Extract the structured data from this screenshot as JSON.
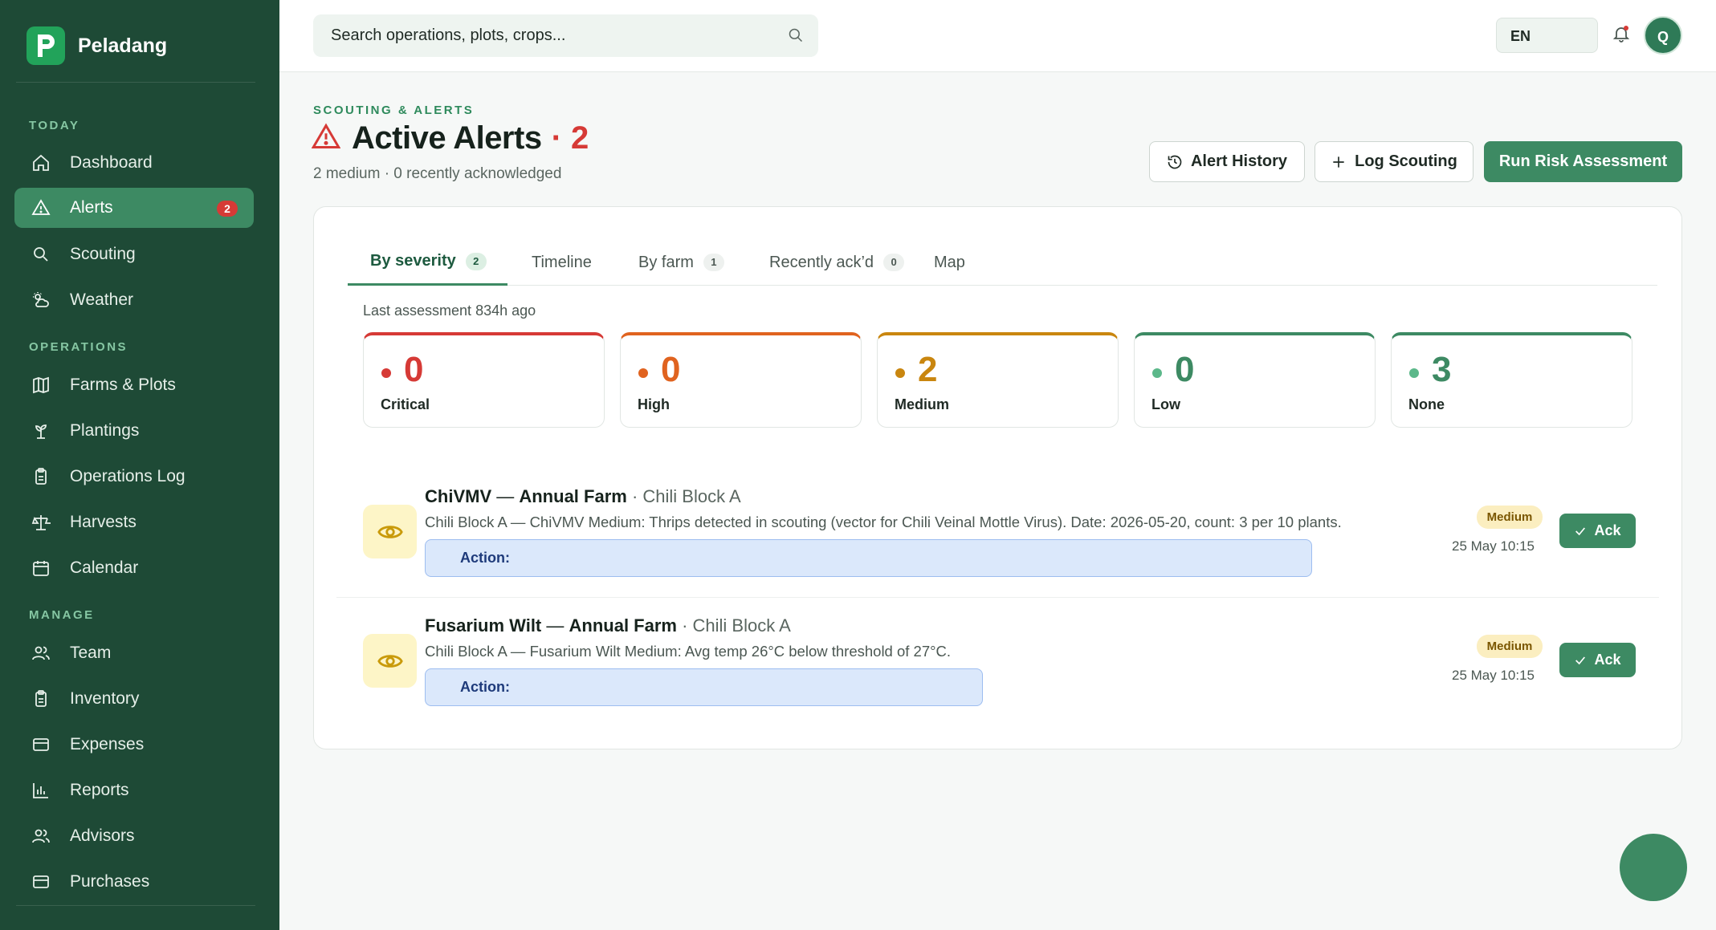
{
  "brand": {
    "name": "Peladang",
    "logo_letter": "P"
  },
  "sidebar": {
    "sections": [
      {
        "label": "TODAY"
      },
      {
        "label": "OPERATIONS"
      },
      {
        "label": "MANAGE"
      }
    ],
    "items": [
      {
        "label": "Dashboard",
        "icon": "home-icon"
      },
      {
        "label": "Alerts",
        "icon": "warning-icon",
        "badge": "2",
        "active": true
      },
      {
        "label": "Scouting",
        "icon": "search-icon"
      },
      {
        "label": "Weather",
        "icon": "weather-icon"
      },
      {
        "label": "Farms & Plots",
        "icon": "map-icon"
      },
      {
        "label": "Plantings",
        "icon": "sprout-icon"
      },
      {
        "label": "Operations Log",
        "icon": "clipboard-icon"
      },
      {
        "label": "Harvests",
        "icon": "scale-icon"
      },
      {
        "label": "Calendar",
        "icon": "calendar-icon"
      },
      {
        "label": "Team",
        "icon": "users-icon"
      },
      {
        "label": "Inventory",
        "icon": "clipboard-icon"
      },
      {
        "label": "Expenses",
        "icon": "card-icon"
      },
      {
        "label": "Reports",
        "icon": "bar-chart-icon"
      },
      {
        "label": "Advisors",
        "icon": "users-icon"
      },
      {
        "label": "Purchases",
        "icon": "card-icon"
      }
    ]
  },
  "topbar": {
    "search_placeholder": "Search operations, plots, crops...",
    "language": "EN",
    "avatar_initial": "Q"
  },
  "header": {
    "eyebrow": "SCOUTING & ALERTS",
    "title": "Active Alerts",
    "count": "· 2",
    "subtitle": "2 medium · 0 recently acknowledged",
    "buttons": {
      "history": "Alert History",
      "log": "Log Scouting",
      "run": "Run Risk Assessment"
    }
  },
  "tabs": [
    {
      "label": "By severity",
      "count": "2",
      "active": true
    },
    {
      "label": "Timeline"
    },
    {
      "label": "By farm",
      "count": "1"
    },
    {
      "label": "Recently ack’d",
      "count": "0"
    },
    {
      "label": "Map"
    }
  ],
  "last_assessment": "Last assessment 834h ago",
  "severity": [
    {
      "label": "Critical",
      "value": "0",
      "color": "#d63a36"
    },
    {
      "label": "High",
      "value": "0",
      "color": "#e0631f"
    },
    {
      "label": "Medium",
      "value": "2",
      "color": "#c9860f"
    },
    {
      "label": "Low",
      "value": "0",
      "color": "#3d9a6c"
    },
    {
      "label": "None",
      "value": "3",
      "color": "#3d8a63"
    }
  ],
  "alerts": [
    {
      "name": "ChiVMV",
      "farm": "Annual Farm",
      "plot": "· Chili Block A",
      "description": "Chili Block A — ChiVMV Medium: Thrips detected in scouting (vector for Chili Veinal Mottle Virus). Date: 2026-05-20, count: 3 per 10 plants.",
      "action_label": "Action:",
      "severity": "Medium",
      "time": "25 May 10:15",
      "ack_label": "Ack"
    },
    {
      "name": "Fusarium Wilt",
      "farm": "Annual Farm",
      "plot": "· Chili Block A",
      "description": "Chili Block A — Fusarium Wilt Medium: Avg temp 26°C below threshold of 27°C.",
      "action_label": "Action:",
      "severity": "Medium",
      "time": "25 May 10:15",
      "ack_label": "Ack"
    }
  ],
  "colors": {
    "sidebar_bg": "#1e4a36",
    "accent": "#3d8a63",
    "danger": "#d63a36"
  }
}
